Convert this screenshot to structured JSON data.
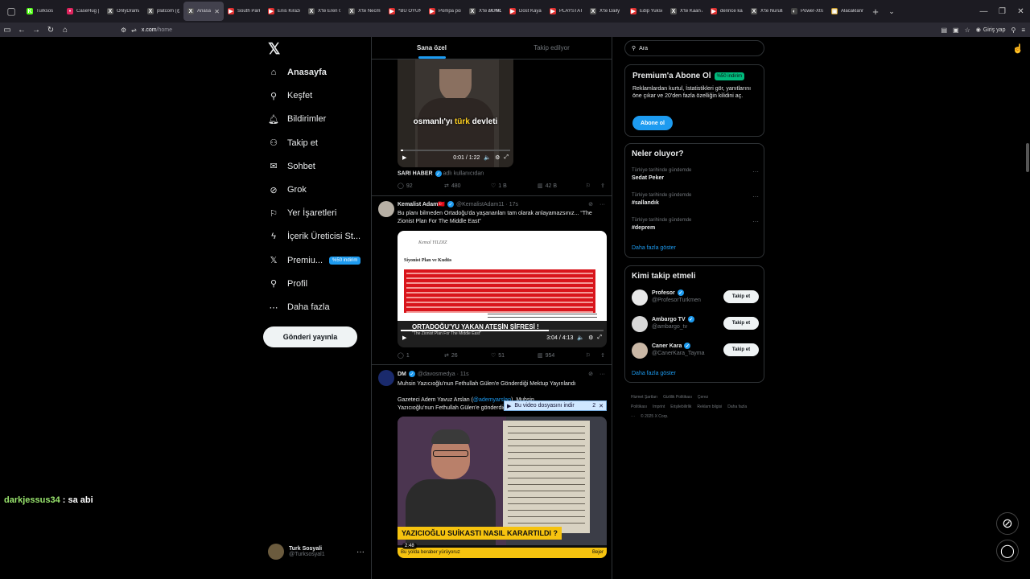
{
  "browser": {
    "tabs": [
      {
        "label": "Turksos",
        "color": "#53fc18",
        "glyph": "K"
      },
      {
        "label": "CaseHug | C",
        "color": "#e0245e",
        "glyph": "•"
      },
      {
        "label": "OnlyDrama",
        "color": "#555555",
        "glyph": "X"
      },
      {
        "label": "platcom (@",
        "color": "#555555",
        "glyph": "X"
      },
      {
        "label": "Anasayfa",
        "color": "#555555",
        "glyph": "X",
        "active": true
      },
      {
        "label": "South Park",
        "color": "#e03030",
        "glyph": "▶"
      },
      {
        "label": "Enis Kirazo",
        "color": "#e03030",
        "glyph": "▶"
      },
      {
        "label": "X'te Eren Ca",
        "color": "#555555",
        "glyph": "X"
      },
      {
        "label": "X'te Necmi",
        "color": "#555555",
        "glyph": "X"
      },
      {
        "label": "*BU OYUN",
        "color": "#e03030",
        "glyph": "▶"
      },
      {
        "label": "Pompa port",
        "color": "#e03030",
        "glyph": "▶"
      },
      {
        "label": "X'te 𝑩𝑶𝑵𝑼𝑺",
        "color": "#555555",
        "glyph": "X"
      },
      {
        "label": "Dost Kayac",
        "color": "#e03030",
        "glyph": "▶"
      },
      {
        "label": "PLAYSTATIC",
        "color": "#e03030",
        "glyph": "▶"
      },
      {
        "label": "X'te Daily T",
        "color": "#555555",
        "glyph": "X"
      },
      {
        "label": "Edip Yuksel",
        "color": "#e03030",
        "glyph": "▶"
      },
      {
        "label": "X'te Kaan A",
        "color": "#555555",
        "glyph": "X"
      },
      {
        "label": "derince kaz",
        "color": "#e03030",
        "glyph": "▶"
      },
      {
        "label": "X'te Nurulla",
        "color": "#555555",
        "glyph": "X"
      },
      {
        "label": "Power-Xtra",
        "color": "#444444",
        "glyph": "◐"
      },
      {
        "label": "Alacaklann",
        "color": "#c89b2a",
        "glyph": "▣"
      }
    ],
    "url_host": "x.com",
    "url_path": "/home",
    "login_label": "Giriş yap"
  },
  "sidebar": {
    "items": [
      {
        "label": "Anasayfa",
        "icon": "home-icon"
      },
      {
        "label": "Keşfet",
        "icon": "search-icon"
      },
      {
        "label": "Bildirimler",
        "icon": "bell-icon"
      },
      {
        "label": "Takip et",
        "icon": "add-user-icon"
      },
      {
        "label": "Sohbet",
        "icon": "mail-icon"
      },
      {
        "label": "Grok",
        "icon": "grok-icon"
      },
      {
        "label": "Yer İşaretleri",
        "icon": "bookmark-icon"
      },
      {
        "label": "İçerik Üreticisi St...",
        "icon": "lightning-icon"
      },
      {
        "label": "Premiu...",
        "icon": "x-icon"
      },
      {
        "label": "Profil",
        "icon": "person-icon"
      },
      {
        "label": "Daha fazla",
        "icon": "more-icon"
      }
    ],
    "premium_badge": "%50 indirim",
    "post_button": "Gönderi yayınla",
    "account": {
      "name": "Turk Sosyali",
      "handle": "@Turksosyal1"
    }
  },
  "feed": {
    "tabs": [
      "Sana özel",
      "Takip edilyor"
    ],
    "tweet1": {
      "caption_pre": "osmanlı'yı ",
      "caption_hl": "türk",
      "caption_post": " devleti",
      "time": "0:01 / 1:22",
      "source_name": "SARI HABER",
      "source_sub": "adlı kullanıcıdan",
      "replies": "92",
      "retweets": "480",
      "likes": "1 B",
      "views": "42 B"
    },
    "tweet2": {
      "name": "Kemalist Adam🇹🇷",
      "handle": "@KemalistAdam11 · 17s",
      "text": "Bu planı bilmeden Ortadoğu'da yaşananları tam olarak anlayamazsınız... “The Zionist Plan For The Middle East”",
      "doc_name": "Kemal YILDIZ",
      "doc_heading": "Siyonist Plan ve Kudüs",
      "video_title": "ORTADOĞU'YU YAKAN ATEŞİN ŞİFRESİ !",
      "video_sub": "\"The Zionist Plan For The Middle East\"",
      "time": "3:04 / 4:13",
      "replies": "1",
      "retweets": "26",
      "likes": "51",
      "views": "954"
    },
    "tweet3": {
      "name": "DM",
      "handle": "@davosmedya · 11s",
      "text": "Muhsin Yazıcıoğlu'nun Fethullah Gülen'e Gönderdiği Mektup Yayınlandı",
      "body_pre": "Gazeteci Adem Yavuz Arslan (",
      "body_link": "@ademyarslan",
      "body_post": "), Muhsin Yazıcıoğlu'nun Fethullah Gülen'e gönderdiği mektubu",
      "banner": "YAZICIOĞLU SUİKASTI NASIL KARARTILDI ?",
      "duration": "2:48",
      "ticker": "Bu yolda beraber yürüyoruz",
      "ticker_right": "Bejer"
    },
    "download_popup": {
      "label": "Bu video dosyasını indir",
      "count": "2"
    }
  },
  "right": {
    "search_placeholder": "Ara",
    "premium": {
      "title": "Premium'a Abone Ol",
      "discount": "%50 indirim",
      "text": "Reklamlardan kurtul, İstatistikleri gör, yanıtlarını öne çıkar ve 20'den fazla özelliğin kilidini aç.",
      "button": "Abone ol"
    },
    "trends": {
      "title": "Neler oluyor?",
      "items": [
        {
          "context": "Türkiye tarihinde gündemde",
          "topic": "Sedat Peker"
        },
        {
          "context": "Türkiye tarihinde gündemde",
          "topic": "#sallandık"
        },
        {
          "context": "Türkiye tarihinde gündemde",
          "topic": "#deprem"
        }
      ],
      "more": "Daha fazla göster"
    },
    "who": {
      "title": "Kimi takip etmeli",
      "items": [
        {
          "name": "Profesor",
          "handle": "@ProfesorTurkmen",
          "button": "Takip et"
        },
        {
          "name": "Ambargo TV",
          "handle": "@ambargo_tv",
          "button": "Takip et"
        },
        {
          "name": "Caner Kara",
          "handle": "@CanerKara_Tayma",
          "button": "Takip et"
        }
      ],
      "more": "Daha fazla göster"
    },
    "footer": [
      "Hizmet Şartları",
      "Gizlilik Politikası",
      "Çerez Politikası",
      "Imprint",
      "Erişilebilirlik",
      "Reklam bilgisi",
      "Daha fazla ···",
      "© 2025 X Corp."
    ]
  },
  "chat": {
    "user": "darkjessus34",
    "message": " : sa abi"
  }
}
